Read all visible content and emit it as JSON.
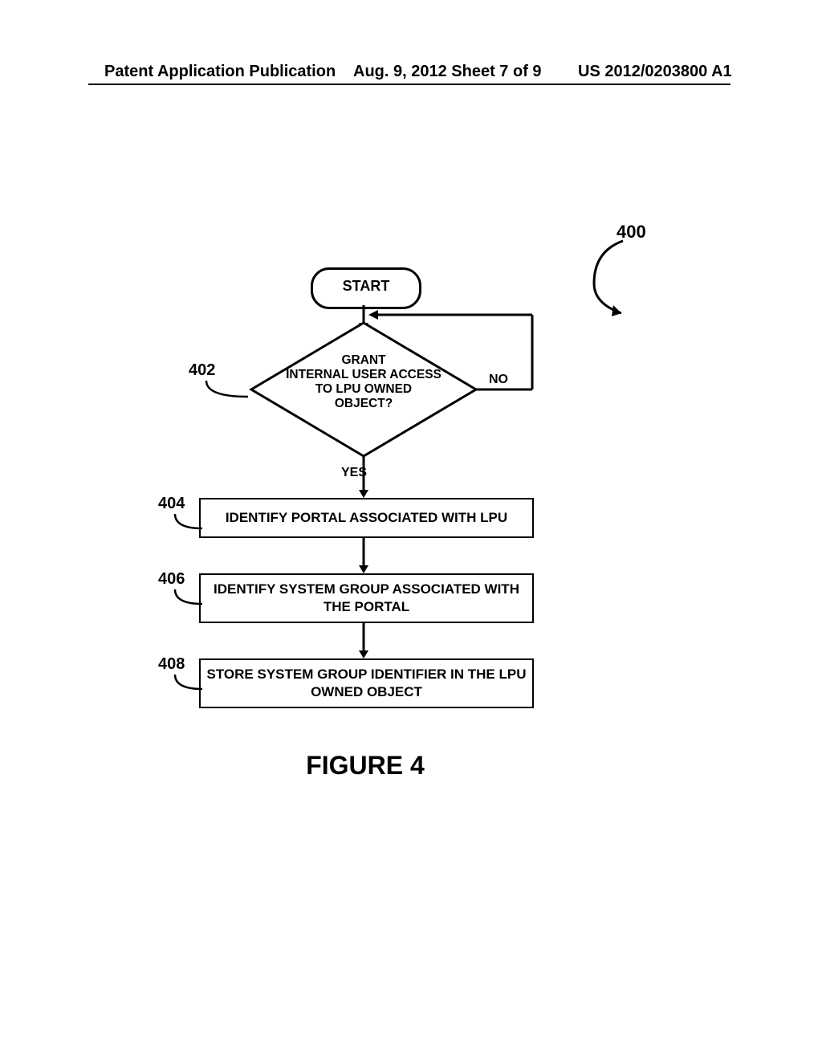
{
  "header": {
    "left": "Patent Application Publication",
    "mid": "Aug. 9, 2012  Sheet 7 of 9",
    "right": "US 2012/0203800 A1"
  },
  "figure": {
    "number_ref": "400",
    "start_label": "START",
    "decision": {
      "ref": "402",
      "text_line1": "GRANT",
      "text_line2": "INTERNAL USER ACCESS",
      "text_line3": "TO LPU OWNED",
      "text_line4": "OBJECT?",
      "yes": "YES",
      "no": "NO"
    },
    "steps": [
      {
        "ref": "404",
        "text": "IDENTIFY PORTAL ASSOCIATED WITH LPU"
      },
      {
        "ref": "406",
        "text": "IDENTIFY SYSTEM GROUP ASSOCIATED WITH THE PORTAL"
      },
      {
        "ref": "408",
        "text": "STORE SYSTEM GROUP IDENTIFIER IN THE LPU OWNED OBJECT"
      }
    ],
    "caption": "FIGURE 4"
  },
  "chart_data": {
    "type": "table",
    "title": "Flowchart 400 – grant internal user access to LPU-owned object",
    "nodes": [
      {
        "id": "start",
        "kind": "terminator",
        "label": "START"
      },
      {
        "id": "402",
        "kind": "decision",
        "label": "GRANT INTERNAL USER ACCESS TO LPU OWNED OBJECT?",
        "yes_to": "404",
        "no_to": "402"
      },
      {
        "id": "404",
        "kind": "process",
        "label": "IDENTIFY PORTAL ASSOCIATED WITH LPU"
      },
      {
        "id": "406",
        "kind": "process",
        "label": "IDENTIFY SYSTEM GROUP ASSOCIATED WITH THE PORTAL"
      },
      {
        "id": "408",
        "kind": "process",
        "label": "STORE SYSTEM GROUP IDENTIFIER IN THE LPU OWNED OBJECT"
      }
    ],
    "edges": [
      {
        "from": "start",
        "to": "402"
      },
      {
        "from": "402",
        "to": "404",
        "label": "YES"
      },
      {
        "from": "402",
        "to": "402",
        "label": "NO"
      },
      {
        "from": "404",
        "to": "406"
      },
      {
        "from": "406",
        "to": "408"
      }
    ]
  }
}
